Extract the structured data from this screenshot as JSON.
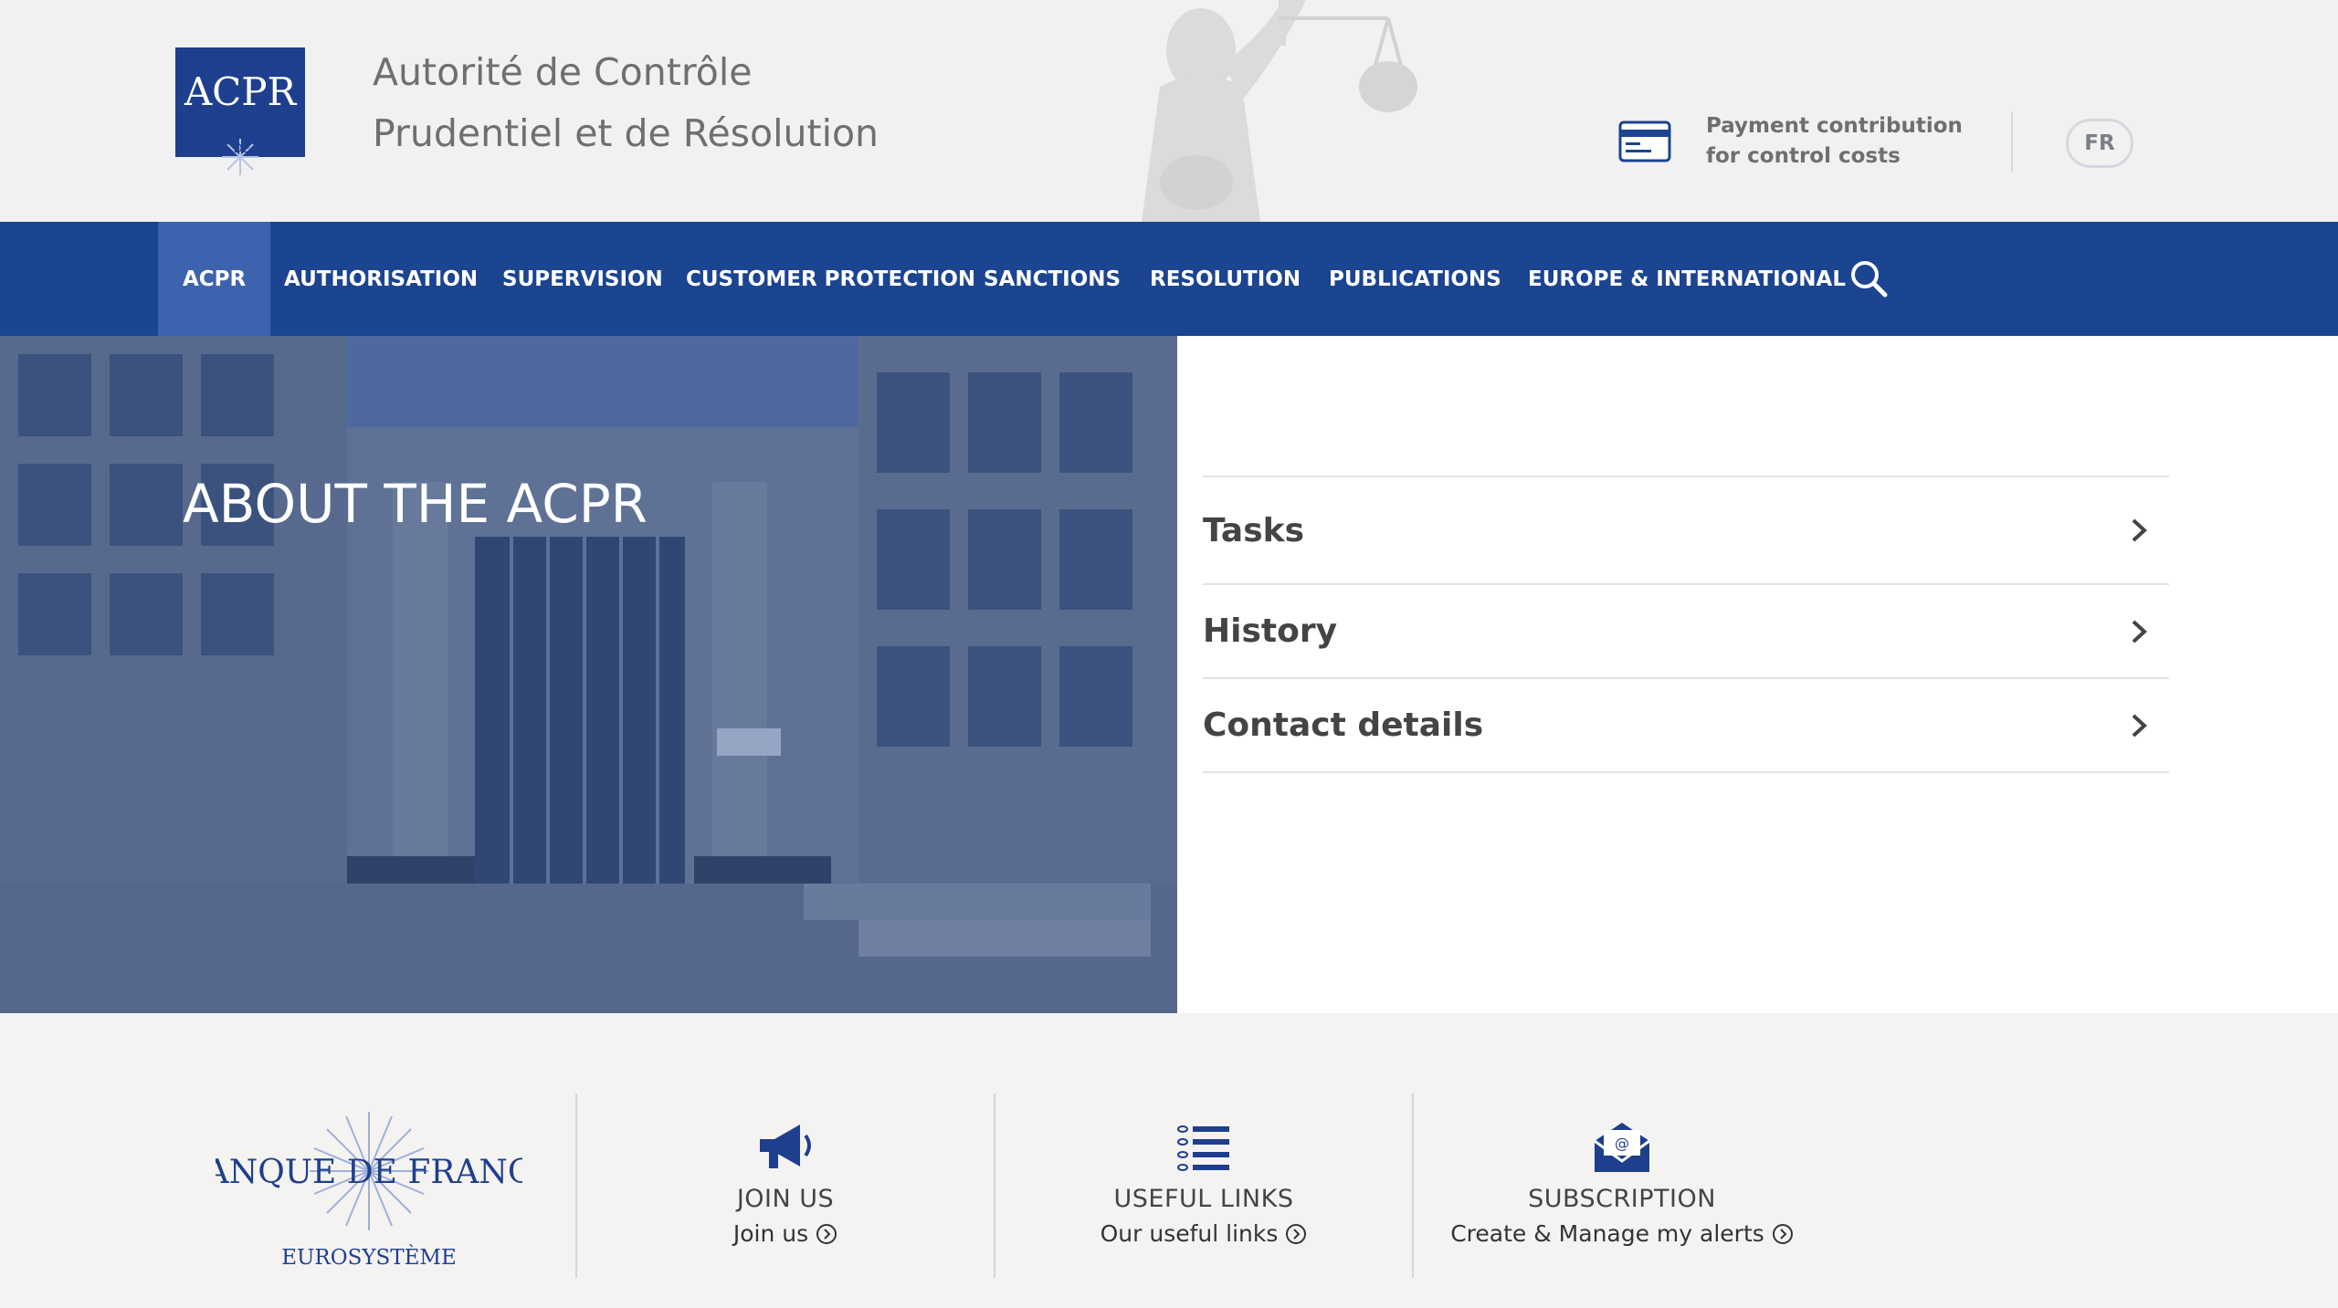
{
  "header": {
    "logo_text": "ACPR",
    "logo_subtext": "BANQUE DE FRANCE",
    "title_line1": "Autorité de Contrôle",
    "title_line2": "Prudentiel et de Résolution",
    "payment_text": "Payment contribution for control costs",
    "payment_icon": "credit-card-icon",
    "lang_label": "FR"
  },
  "nav": {
    "items": [
      {
        "label": "ACPR",
        "active": true
      },
      {
        "label": "AUTHORISATION"
      },
      {
        "label": "SUPERVISION"
      },
      {
        "label": "CUSTOMER PROTECTION"
      },
      {
        "label": "SANCTIONS"
      },
      {
        "label": "RESOLUTION"
      },
      {
        "label": "PUBLICATIONS"
      },
      {
        "label": "EUROPE & INTERNATIONAL"
      }
    ],
    "search_icon": "search-icon"
  },
  "hero": {
    "title": "ABOUT THE ACPR"
  },
  "panel": {
    "items": [
      {
        "label": "Tasks"
      },
      {
        "label": "History"
      },
      {
        "label": "Contact details"
      }
    ]
  },
  "footer": {
    "logo_text": "BANQUE DE FRANCE",
    "logo_subtext": "EUROSYSTÈME",
    "blocks": [
      {
        "title": "JOIN US",
        "link": "Join us",
        "icon": "megaphone-icon"
      },
      {
        "title": "USEFUL LINKS",
        "link": "Our useful links",
        "icon": "link-list-icon"
      },
      {
        "title": "SUBSCRIPTION",
        "link": "Create & Manage my alerts",
        "icon": "envelope-icon"
      }
    ]
  },
  "colors": {
    "nav_bg": "#1b4491",
    "nav_active": "#3d63ae",
    "brand_blue": "#1e3f8e"
  }
}
